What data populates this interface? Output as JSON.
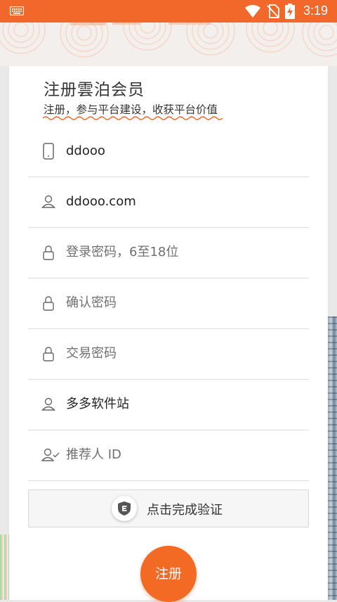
{
  "status_bar": {
    "time": "3:19",
    "icons": [
      "keyboard-icon",
      "wifi-icon",
      "no-sim-icon",
      "battery-charging-icon"
    ]
  },
  "form": {
    "title": "注册雲泊会员",
    "subtitle": "注册，参与平台建设，收获平台价值",
    "fields": [
      {
        "icon": "phone-icon",
        "value": "ddooo",
        "placeholder": ""
      },
      {
        "icon": "user-icon",
        "value": "ddooo.com",
        "placeholder": ""
      },
      {
        "icon": "lock-icon",
        "value": "",
        "placeholder": "登录密码，6至18位"
      },
      {
        "icon": "lock-icon",
        "value": "",
        "placeholder": "确认密码"
      },
      {
        "icon": "lock-icon",
        "value": "",
        "placeholder": "交易密码"
      },
      {
        "icon": "user-icon",
        "value": "多多软件站",
        "placeholder": ""
      },
      {
        "icon": "user-check-icon",
        "value": "",
        "placeholder": "推荐人 ID"
      }
    ],
    "verify_label": "点击完成验证",
    "verify_icon": "shield-icon",
    "submit_label": "注册"
  },
  "colors": {
    "accent": "#f26a24",
    "status_bar": "#f2682a",
    "wavy_underline": "#f26a24"
  }
}
